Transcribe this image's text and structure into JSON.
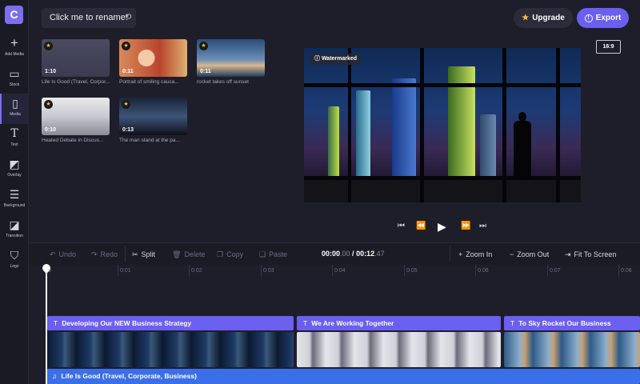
{
  "app": {
    "logo_letter": "C",
    "project_name": "Click me to rename!"
  },
  "sidebar": {
    "items": [
      {
        "label": "Add Media",
        "icon": "plus-icon"
      },
      {
        "label": "Stock",
        "icon": "stock-icon"
      },
      {
        "label": "Media",
        "icon": "media-icon"
      },
      {
        "label": "Text",
        "icon": "text-icon"
      },
      {
        "label": "Overlay",
        "icon": "overlay-icon"
      },
      {
        "label": "Background",
        "icon": "background-icon"
      },
      {
        "label": "Transition",
        "icon": "transition-icon"
      },
      {
        "label": "Logo",
        "icon": "logo-icon"
      }
    ],
    "active_index": 2
  },
  "header": {
    "upgrade_label": "Upgrade",
    "export_label": "Export"
  },
  "media": [
    {
      "title": "Life Is Good (Travel, Corpor...",
      "duration": "1:10"
    },
    {
      "title": "Portrait of smiling cauca...",
      "duration": "0:11"
    },
    {
      "title": "rocket takes off sunset",
      "duration": "0:11"
    },
    {
      "title": "Heated Debate in Discus...",
      "duration": "0:10"
    },
    {
      "title": "The man stand at the pa...",
      "duration": "0:13"
    }
  ],
  "preview": {
    "aspect_ratio": "16:9",
    "watermark": "Watermarked"
  },
  "toolbar": {
    "undo": "Undo",
    "redo": "Redo",
    "split": "Split",
    "delete": "Delete",
    "copy": "Copy",
    "paste": "Paste",
    "time_current": "00:00",
    "time_current_ms": ".00",
    "time_sep": " / ",
    "time_total": "00:12",
    "time_total_ms": ".47",
    "zoom_in": "Zoom In",
    "zoom_out": "Zoom Out",
    "fit": "Fit To Screen"
  },
  "ruler": {
    "ticks": [
      "0",
      "0:01",
      "0:02",
      "0:03",
      "0:04",
      "0:05",
      "0:06",
      "0:07",
      "0:08"
    ]
  },
  "timeline": {
    "text_clips": [
      "Developing Our NEW Business Strategy",
      "We Are Working Together",
      "To Sky Rocket Our Business"
    ],
    "audio_clip": "Life Is Good (Travel, Corporate, Business)"
  }
}
